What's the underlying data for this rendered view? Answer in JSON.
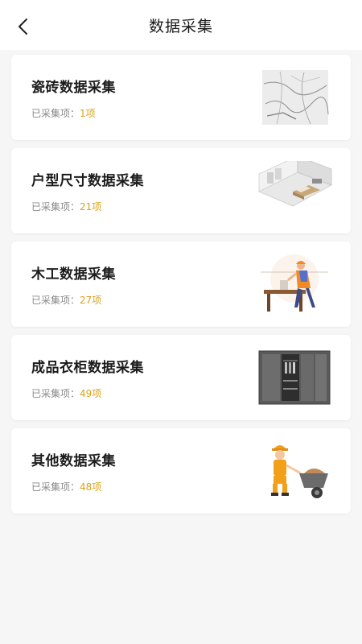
{
  "header": {
    "title": "数据采集",
    "back_icon": "chevron-left-icon"
  },
  "accent_color": "#d9a21c",
  "cards": [
    {
      "title": "瓷砖数据采集",
      "count_label": "已采集项：",
      "count_value": "1项",
      "image": "marble-tile-image"
    },
    {
      "title": "户型尺寸数据采集",
      "count_label": "已采集项：",
      "count_value": "21项",
      "image": "room-layout-image"
    },
    {
      "title": "木工数据采集",
      "count_label": "已采集项：",
      "count_value": "27项",
      "image": "carpenter-image"
    },
    {
      "title": "成品衣柜数据采集",
      "count_label": "已采集项：",
      "count_value": "49项",
      "image": "wardrobe-image"
    },
    {
      "title": "其他数据采集",
      "count_label": "已采集项：",
      "count_value": "48项",
      "image": "worker-wheelbarrow-image"
    }
  ]
}
